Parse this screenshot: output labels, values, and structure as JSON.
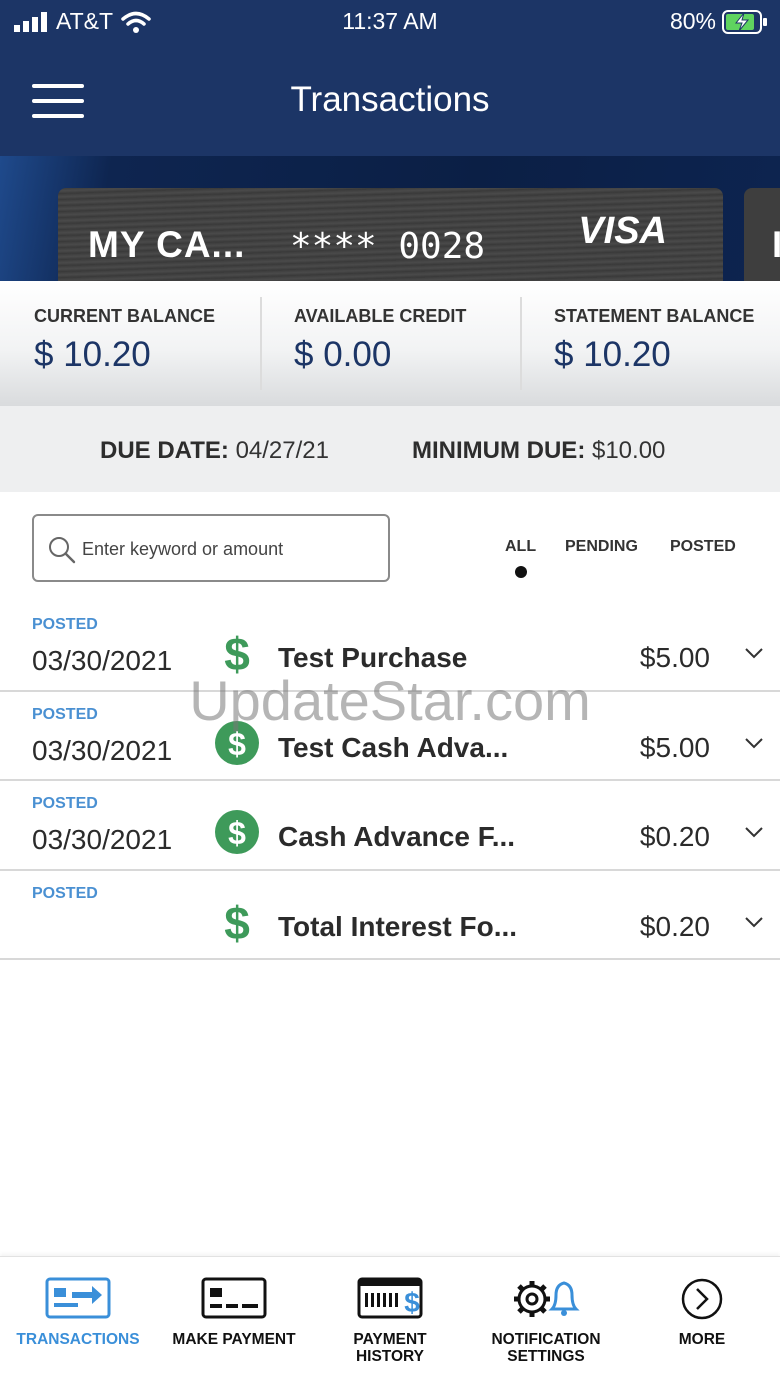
{
  "status_bar": {
    "carrier": "AT&T",
    "time": "11:37 AM",
    "battery": "80%"
  },
  "header": {
    "title": "Transactions"
  },
  "card": {
    "name": "MY CA...",
    "number": "**** 0028",
    "brand": "VISA",
    "next_card_initial": "I"
  },
  "balances": [
    {
      "label": "CURRENT BALANCE",
      "value": "$ 10.20"
    },
    {
      "label": "AVAILABLE CREDIT",
      "value": "$ 0.00"
    },
    {
      "label": "STATEMENT BALANCE",
      "value": "$ 10.20"
    }
  ],
  "due": {
    "due_date_label": "DUE DATE:",
    "due_date": "04/27/21",
    "min_due_label": "MINIMUM DUE:",
    "min_due": "$10.00"
  },
  "search": {
    "placeholder": "Enter keyword or amount"
  },
  "filters": {
    "all": "ALL",
    "pending": "PENDING",
    "posted": "POSTED",
    "selected": "ALL"
  },
  "transactions": [
    {
      "status": "POSTED",
      "date": "03/30/2021",
      "description": "Test Purchase",
      "amount": "$5.00",
      "icon": "dollar-sign-icon"
    },
    {
      "status": "POSTED",
      "date": "03/30/2021",
      "description": "Test Cash Adva...",
      "amount": "$5.00",
      "icon": "dollar-circle-icon"
    },
    {
      "status": "POSTED",
      "date": "03/30/2021",
      "description": "Cash Advance F...",
      "amount": "$0.20",
      "icon": "dollar-circle-icon"
    },
    {
      "status": "POSTED",
      "date": "",
      "description": "Total Interest Fo...",
      "amount": "$0.20",
      "icon": "dollar-sign-icon"
    }
  ],
  "watermark": "UpdateStar.com",
  "bottom_nav": [
    {
      "label": "TRANSACTIONS",
      "icon": "transactions-icon",
      "active": true
    },
    {
      "label": "MAKE PAYMENT",
      "icon": "card-payment-icon",
      "active": false
    },
    {
      "label": "PAYMENT\nHISTORY",
      "icon": "payment-history-icon",
      "active": false
    },
    {
      "label": "NOTIFICATION\nSETTINGS",
      "icon": "gear-bell-icon",
      "active": false
    },
    {
      "label": "MORE",
      "icon": "chevron-right-circle-icon",
      "active": false
    }
  ],
  "colors": {
    "header": "#1c3566",
    "accent": "#3a8fd9",
    "posted": "#4a90d2",
    "dollar_green": "#3e9a5a",
    "balance_value": "#1c3566"
  }
}
